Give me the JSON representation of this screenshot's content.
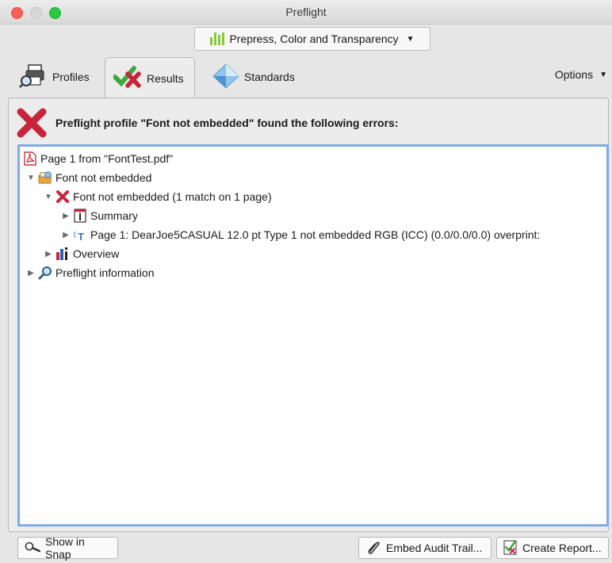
{
  "window": {
    "title": "Preflight"
  },
  "profile_selector": {
    "value": "Prepress, Color and Transparency"
  },
  "tabs": [
    {
      "label": "Profiles"
    },
    {
      "label": "Results"
    },
    {
      "label": "Standards"
    }
  ],
  "options_label": "Options",
  "result_message": "Preflight profile \"Font not embedded\" found the following errors:",
  "tree": {
    "root": "Page 1 from \"FontTest.pdf\"",
    "group": "Font not embedded",
    "rule": "Font not embedded (1 match on 1 page)",
    "summary": "Summary",
    "match": "Page 1: DearJoe5CASUAL 12.0 pt Type 1 not embedded RGB (ICC) (0.0/0.0/0.0)  overprint:",
    "overview": "Overview",
    "info": "Preflight information"
  },
  "buttons": {
    "show_in_snap": "Show in Snap",
    "embed_audit_trail": "Embed Audit Trail...",
    "create_report": "Create Report..."
  },
  "colors": {
    "accent_border": "#7eabe8",
    "error_red": "#c8243c",
    "ok_green": "#3fa83a"
  }
}
